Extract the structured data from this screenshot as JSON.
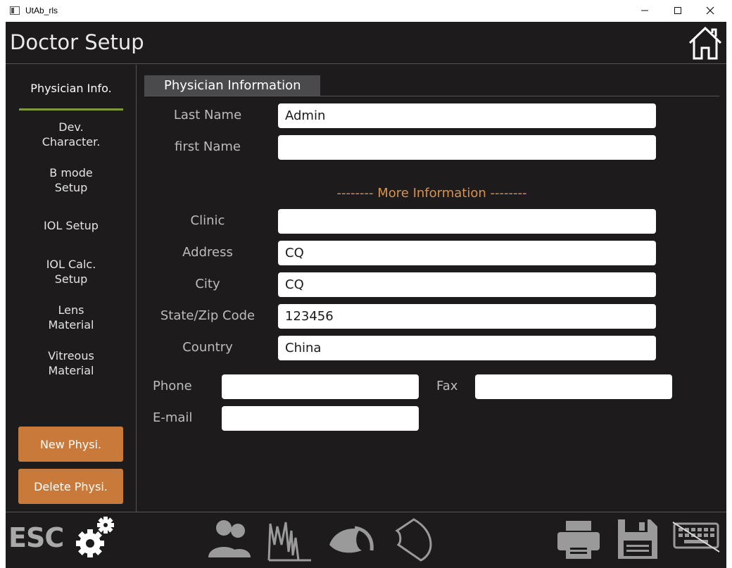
{
  "window": {
    "title": "UtAb_rls",
    "minimize": "—",
    "maximize": "☐",
    "close": "✕"
  },
  "header": {
    "title": "Doctor Setup"
  },
  "sidebar": {
    "items": [
      {
        "label": "Physician Info.",
        "active": true
      },
      {
        "label": "Dev.\nCharacter."
      },
      {
        "label": "B mode\nSetup"
      },
      {
        "label": "IOL Setup"
      },
      {
        "label": "IOL Calc.\nSetup"
      },
      {
        "label": "Lens\nMaterial"
      },
      {
        "label": "Vitreous\nMaterial"
      }
    ],
    "new_button": "New Physi.",
    "delete_button": "Delete Physi."
  },
  "main": {
    "section_title": "Physician Information",
    "more_info": "--------  More Information  --------",
    "fields": {
      "last_name": {
        "label": "Last Name",
        "value": "Admin"
      },
      "first_name": {
        "label": "first Name",
        "value": ""
      },
      "clinic": {
        "label": "Clinic",
        "value": ""
      },
      "address": {
        "label": "Address",
        "value": "CQ"
      },
      "city": {
        "label": "City",
        "value": "CQ"
      },
      "state_zip": {
        "label": "State/Zip Code",
        "value": "123456"
      },
      "country": {
        "label": "Country",
        "value": "China"
      },
      "phone": {
        "label": "Phone",
        "value": ""
      },
      "fax": {
        "label": "Fax",
        "value": ""
      },
      "email": {
        "label": "E-mail",
        "value": ""
      }
    }
  },
  "footer": {
    "esc_label": "ESC",
    "icons": [
      "gear-icon",
      "patients-icon",
      "waveform-icon",
      "eye-icon",
      "lens-icon",
      "printer-icon",
      "save-icon",
      "keyboard-icon"
    ]
  },
  "colors": {
    "background": "#1d1b1c",
    "accent_orange": "#c97a3a",
    "active_underline": "#7d9a3a",
    "more_info_text": "#d9924a"
  }
}
